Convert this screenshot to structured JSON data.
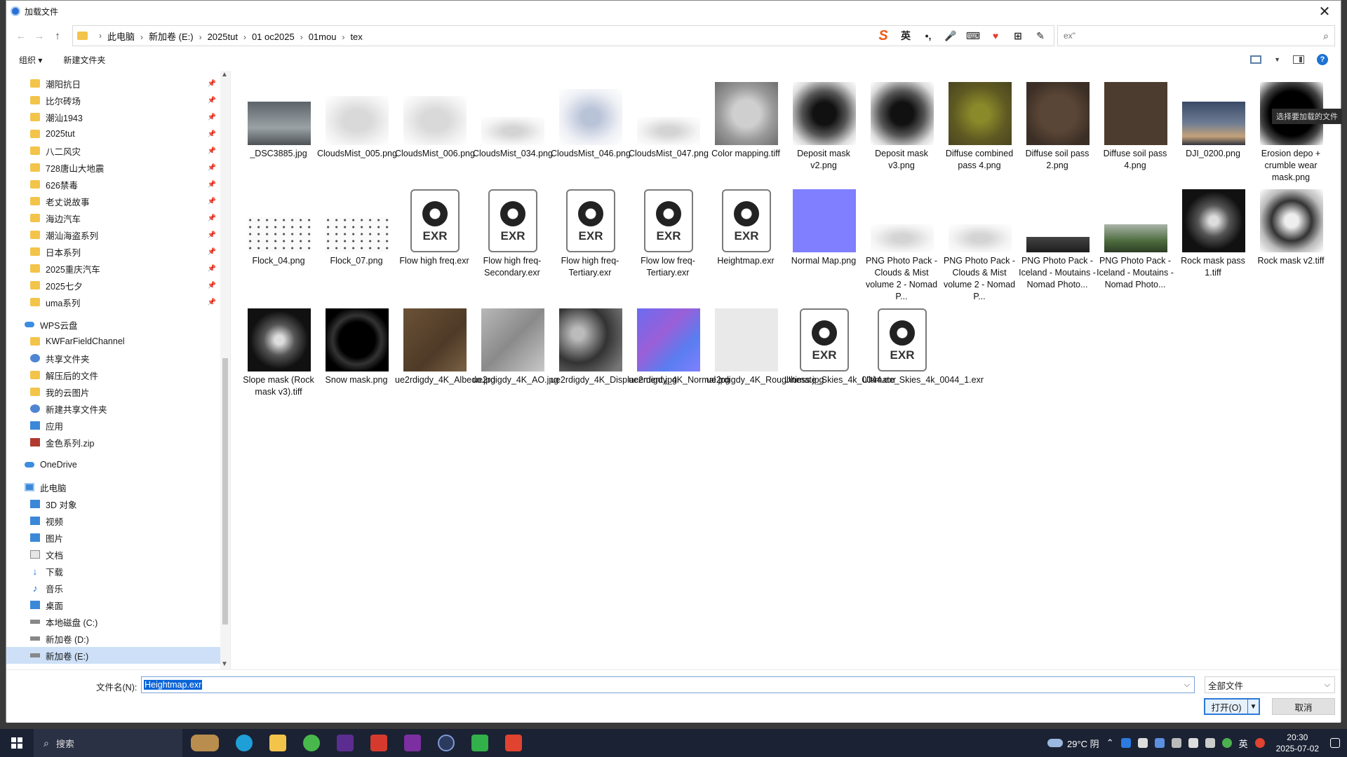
{
  "window": {
    "title": "加载文件",
    "close_glyph": "✕"
  },
  "nav_buttons": {
    "back": "←",
    "forward": "→",
    "up": "↑"
  },
  "breadcrumb": [
    "此电脑",
    "新加卷 (E:)",
    "2025tut",
    "01 oc2025",
    "01mou",
    "tex"
  ],
  "ime_toolbar": [
    "S",
    "英",
    "•,",
    "🎤",
    "⌨",
    "♥",
    "⊞",
    "✎"
  ],
  "search": {
    "text": "ex\"",
    "icon": "search-icon"
  },
  "toolbar": {
    "organize": "组织 ▾",
    "new_folder": "新建文件夹"
  },
  "sidebar": {
    "quick_access": [
      {
        "label": "潮阳抗日",
        "icon": "folder-icon"
      },
      {
        "label": "比尔砖场",
        "icon": "folder-icon"
      },
      {
        "label": "潮汕1943",
        "icon": "folder-icon"
      },
      {
        "label": "2025tut",
        "icon": "folder-icon"
      },
      {
        "label": "八二风灾",
        "icon": "folder-icon"
      },
      {
        "label": "728唐山大地震",
        "icon": "folder-icon"
      },
      {
        "label": "626禁毒",
        "icon": "folder-icon"
      },
      {
        "label": "老丈说故事",
        "icon": "folder-icon"
      },
      {
        "label": "海边汽车",
        "icon": "folder-icon"
      },
      {
        "label": "潮汕海盗系列",
        "icon": "folder-icon"
      },
      {
        "label": "日本系列",
        "icon": "folder-icon"
      },
      {
        "label": "2025重庆汽车",
        "icon": "folder-icon"
      },
      {
        "label": "2025七夕",
        "icon": "folder-icon"
      },
      {
        "label": "uma系列",
        "icon": "folder-icon"
      }
    ],
    "wps_root": "WPS云盘",
    "wps_items": [
      {
        "label": "KWFarFieldChannel",
        "icon": "folder-icon"
      },
      {
        "label": "共享文件夹",
        "icon": "share-icon"
      },
      {
        "label": "解压后的文件",
        "icon": "folder-icon"
      },
      {
        "label": "我的云图片",
        "icon": "folder-icon"
      },
      {
        "label": "新建共享文件夹",
        "icon": "share-icon"
      },
      {
        "label": "应用",
        "icon": "apps-icon"
      },
      {
        "label": "金色系列.zip",
        "icon": "zip-icon"
      }
    ],
    "onedrive": "OneDrive",
    "pc_root": "此电脑",
    "pc_items": [
      {
        "label": "3D 对象",
        "icon": "cube-icon"
      },
      {
        "label": "视频",
        "icon": "video-icon"
      },
      {
        "label": "图片",
        "icon": "pictures-icon"
      },
      {
        "label": "文档",
        "icon": "documents-icon"
      },
      {
        "label": "下载",
        "icon": "download-icon"
      },
      {
        "label": "音乐",
        "icon": "music-icon"
      },
      {
        "label": "桌面",
        "icon": "desktop-icon"
      },
      {
        "label": "本地磁盘 (C:)",
        "icon": "drive-icon"
      },
      {
        "label": "新加卷 (D:)",
        "icon": "drive-icon"
      },
      {
        "label": "新加卷 (E:)",
        "icon": "drive-icon",
        "selected": true
      }
    ]
  },
  "files": [
    {
      "name": "_DSC3885.jpg",
      "thumb": "landscape-sky"
    },
    {
      "name": "CloudsMist_005.png",
      "thumb": "mist"
    },
    {
      "name": "CloudsMist_006.png",
      "thumb": "mist"
    },
    {
      "name": "CloudsMist_034.png",
      "thumb": "mist-low"
    },
    {
      "name": "CloudsMist_046.png",
      "thumb": "mist-blue"
    },
    {
      "name": "CloudsMist_047.png",
      "thumb": "mist-low"
    },
    {
      "name": "Color mapping.tiff",
      "thumb": "gray-disc"
    },
    {
      "name": "Deposit mask v2.png",
      "thumb": "dark-splash"
    },
    {
      "name": "Deposit mask v3.png",
      "thumb": "dark-splash"
    },
    {
      "name": "Diffuse combined pass 4.png",
      "thumb": "olive"
    },
    {
      "name": "Diffuse soil pass 2.png",
      "thumb": "brown-disc"
    },
    {
      "name": "Diffuse soil pass 4.png",
      "thumb": "brown"
    },
    {
      "name": "DJI_0200.png",
      "thumb": "dusk-sky"
    },
    {
      "name": "Erosion depo + crumble wear mask.png",
      "thumb": "black-blob"
    },
    {
      "name": "Flock_04.png",
      "thumb": "birds"
    },
    {
      "name": "Flock_07.png",
      "thumb": "birds"
    },
    {
      "name": "Flow high freq.exr",
      "thumb": "exr"
    },
    {
      "name": "Flow high freq-Secondary.exr",
      "thumb": "exr"
    },
    {
      "name": "Flow high freq-Tertiary.exr",
      "thumb": "exr"
    },
    {
      "name": "Flow low freq-Tertiary.exr",
      "thumb": "exr"
    },
    {
      "name": "Heightmap.exr",
      "thumb": "exr"
    },
    {
      "name": "Normal Map.png",
      "thumb": "normal-flat"
    },
    {
      "name": "PNG Photo Pack - Clouds & Mist volume 2 - Nomad P...",
      "thumb": "mist-low"
    },
    {
      "name": "PNG Photo Pack - Clouds & Mist volume 2 - Nomad P...",
      "thumb": "mist-low"
    },
    {
      "name": "PNG Photo Pack - Iceland - Moutains - Nomad Photo...",
      "thumb": "mountain-dark"
    },
    {
      "name": "PNG Photo Pack - Iceland - Moutains - Nomad Photo...",
      "thumb": "mountain-green"
    },
    {
      "name": "Rock mask pass 1.tiff",
      "thumb": "rock-bw"
    },
    {
      "name": "Rock mask v2.tiff",
      "thumb": "rock-bw-light"
    },
    {
      "name": "Slope mask (Rock mask v3).tiff",
      "thumb": "rock-bw"
    },
    {
      "name": "Snow mask.png",
      "thumb": "snow-black"
    },
    {
      "name": "ue2rdigdy_4K_Albedo.jpg",
      "thumb": "albedo"
    },
    {
      "name": "ue2rdigdy_4K_AO.jpg",
      "thumb": "ao"
    },
    {
      "name": "ue2rdigdy_4K_Displacement.jpg",
      "thumb": "displacement"
    },
    {
      "name": "ue2rdigdy_4K_Normal.jpg",
      "thumb": "normal-rough"
    },
    {
      "name": "ue2rdigdy_4K_Roughness.jpg",
      "thumb": "roughness"
    },
    {
      "name": "Ultimate_Skies_4k_0044.exr",
      "thumb": "exr"
    },
    {
      "name": "Ultimate_Skies_4k_0044_1.exr",
      "thumb": "exr"
    }
  ],
  "exr_label": "EXR",
  "tooltip": "选择要加载的文件",
  "bottom": {
    "filename_label": "文件名(N):",
    "filename_value": "Heightmap.exr",
    "filetype_value": "全部文件",
    "open_label": "打开(O)",
    "cancel_label": "取消"
  },
  "taskbar": {
    "search_label": "搜索",
    "weather": "29°C 阴",
    "ime": "英",
    "time": "20:30",
    "date": "2025-07-02"
  },
  "colors": {
    "accent": "#0a64d8",
    "folder": "#f3c44a",
    "normal_map": "#7f7fff"
  }
}
